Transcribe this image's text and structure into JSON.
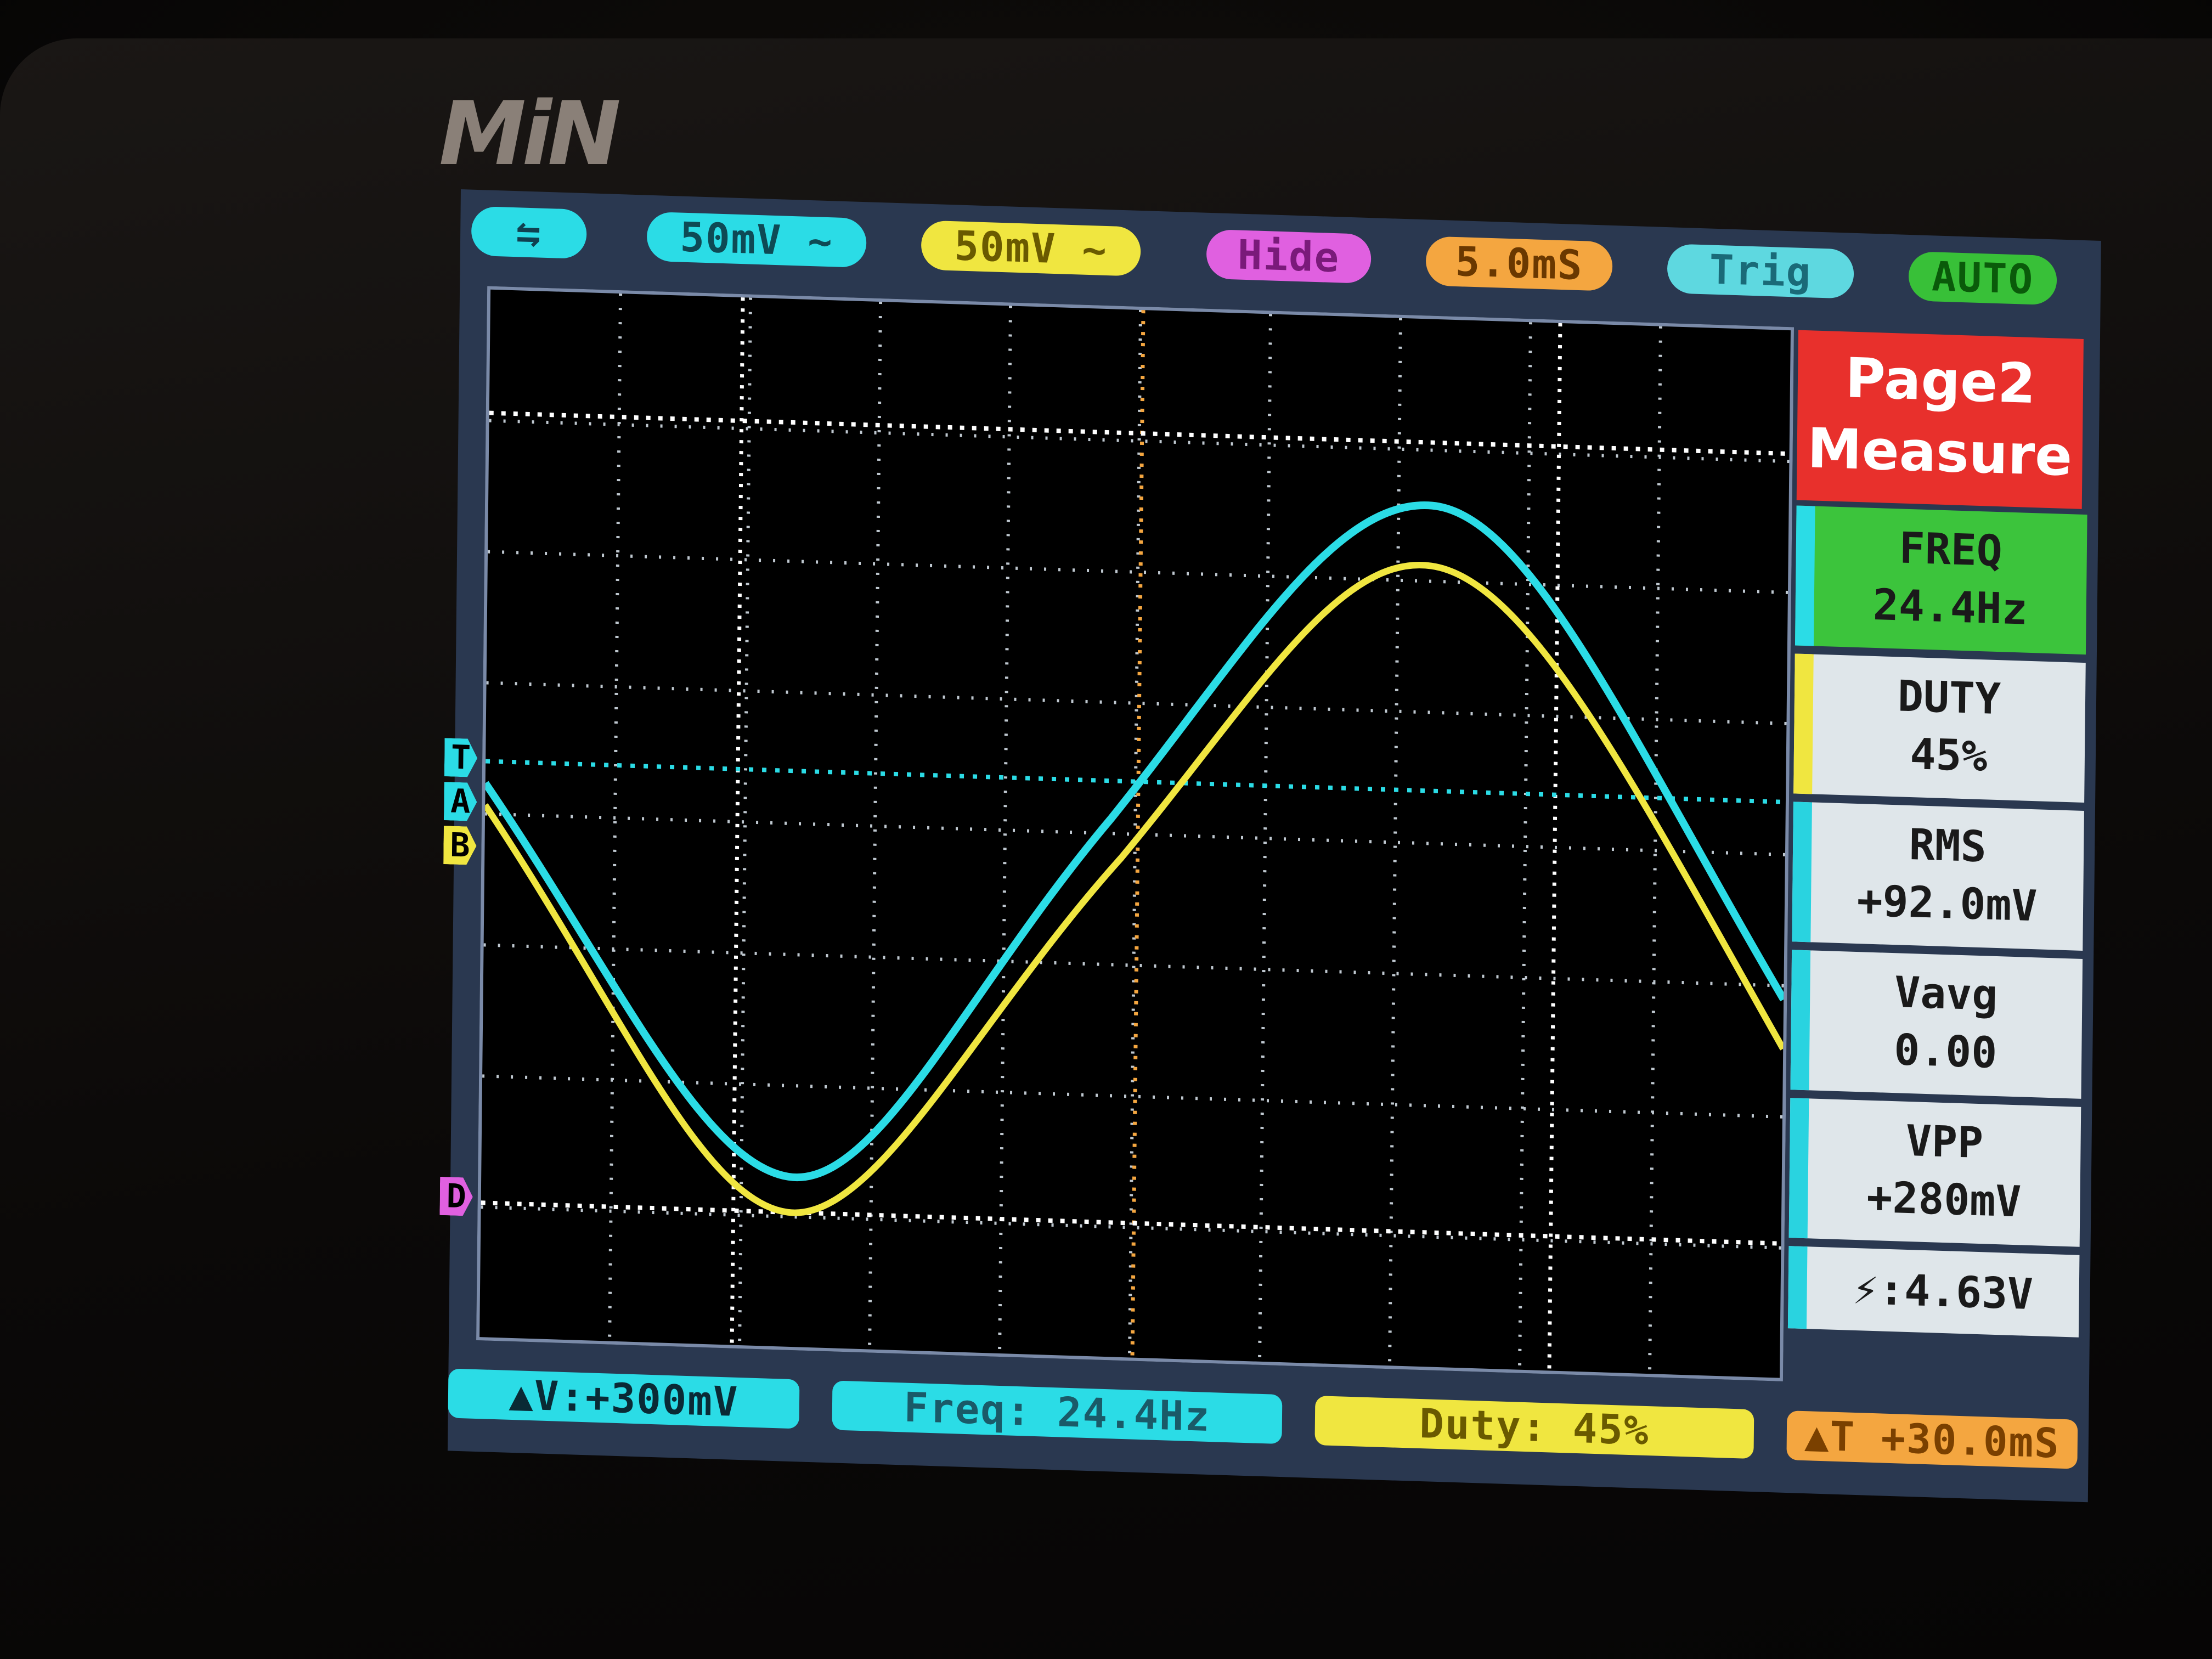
{
  "brand": {
    "logo": "MiN"
  },
  "top_bar": {
    "usb_icon": "usb-icon",
    "channel_a_scale": "50mV ~",
    "channel_b_scale": "50mV ~",
    "math_mode": "Hide",
    "timebase": "5.0mS",
    "trigger": "Trig",
    "run_mode": "AUTO"
  },
  "markers": {
    "trigger": "T",
    "channel_a": "A",
    "channel_b": "B",
    "math": "D"
  },
  "side_panel": {
    "page_title_line1": "Page2",
    "page_title_line2": "Measure",
    "freq_label": "FREQ",
    "freq_value": "24.4Hz",
    "duty_label": "DUTY",
    "duty_value": "45%",
    "rms_label": "RMS",
    "rms_value": "+92.0mV",
    "vavg_label": "Vavg",
    "vavg_value": "0.00",
    "vpp_label": "VPP",
    "vpp_value": "+280mV",
    "battery": "⚡:4.63V"
  },
  "bottom_bar": {
    "delta_v": "▲V:+300mV",
    "freq": "Freq: 24.4Hz",
    "duty": "Duty: 45%",
    "delta_t": "▲T +30.0mS"
  },
  "colors": {
    "channel_a": "#2bdce6",
    "channel_b": "#f0e640",
    "math": "#e060e0",
    "timebase": "#f4a640",
    "trigger": "#5ed8e0",
    "auto": "#38c038",
    "page_box": "#e8302c",
    "freq_box": "#3cc43c"
  }
}
